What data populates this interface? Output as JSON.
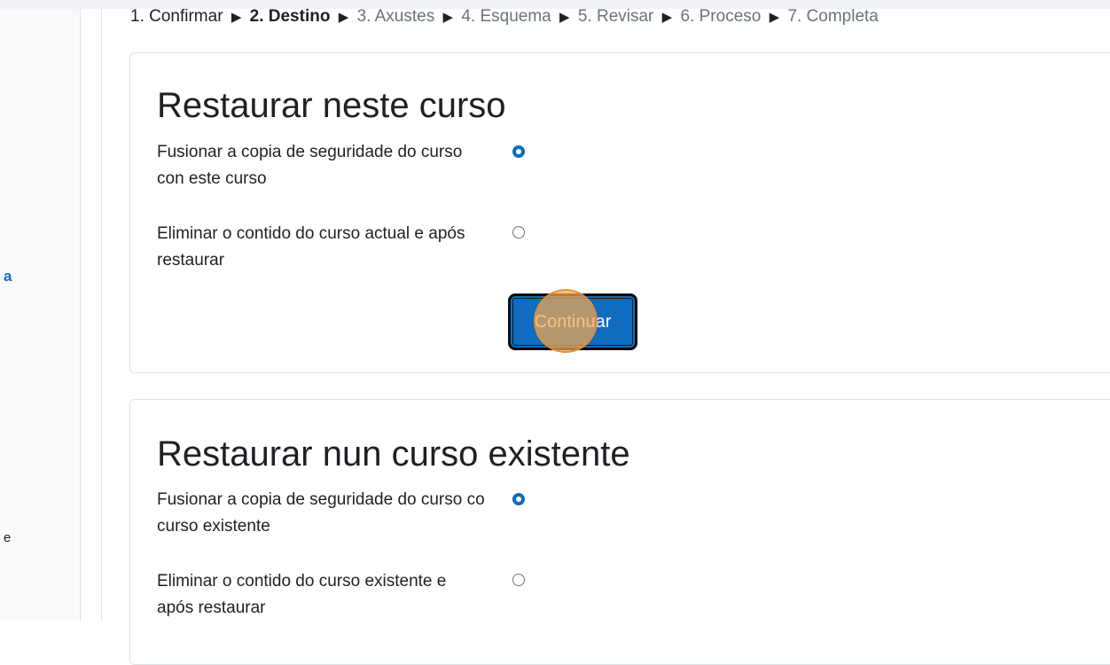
{
  "drawer": {
    "fragment_1": "a",
    "fragment_2": "e"
  },
  "breadcrumb": {
    "steps": [
      {
        "label": "1. Confirmar",
        "state": "done"
      },
      {
        "label": "2. Destino",
        "state": "current"
      },
      {
        "label": "3. Axustes",
        "state": "future"
      },
      {
        "label": "4. Esquema",
        "state": "future"
      },
      {
        "label": "5. Revisar",
        "state": "future"
      },
      {
        "label": "6. Proceso",
        "state": "future"
      },
      {
        "label": "7. Completa",
        "state": "future"
      }
    ],
    "separator": "▶"
  },
  "restore_this_course": {
    "title": "Restaurar neste curso",
    "options": [
      {
        "label": "Fusionar a copia de seguridade do curso con este curso",
        "checked": true
      },
      {
        "label": "Eliminar o contido do curso actual e após restaurar",
        "checked": false
      }
    ],
    "continue_label": "Continuar"
  },
  "restore_existing_course": {
    "title": "Restaurar nun curso existente",
    "options": [
      {
        "label": "Fusionar a copia de seguridade do curso co curso existente",
        "checked": true
      },
      {
        "label": "Eliminar o contido do curso existente e após restaurar",
        "checked": false
      }
    ]
  },
  "colors": {
    "primary": "#0f6cbf",
    "click_indicator": "#f5a850"
  },
  "icons": {
    "separator": "play-triangle-icon",
    "radio_checked": "radio-checked-icon",
    "radio_unchecked": "radio-unchecked-icon"
  }
}
